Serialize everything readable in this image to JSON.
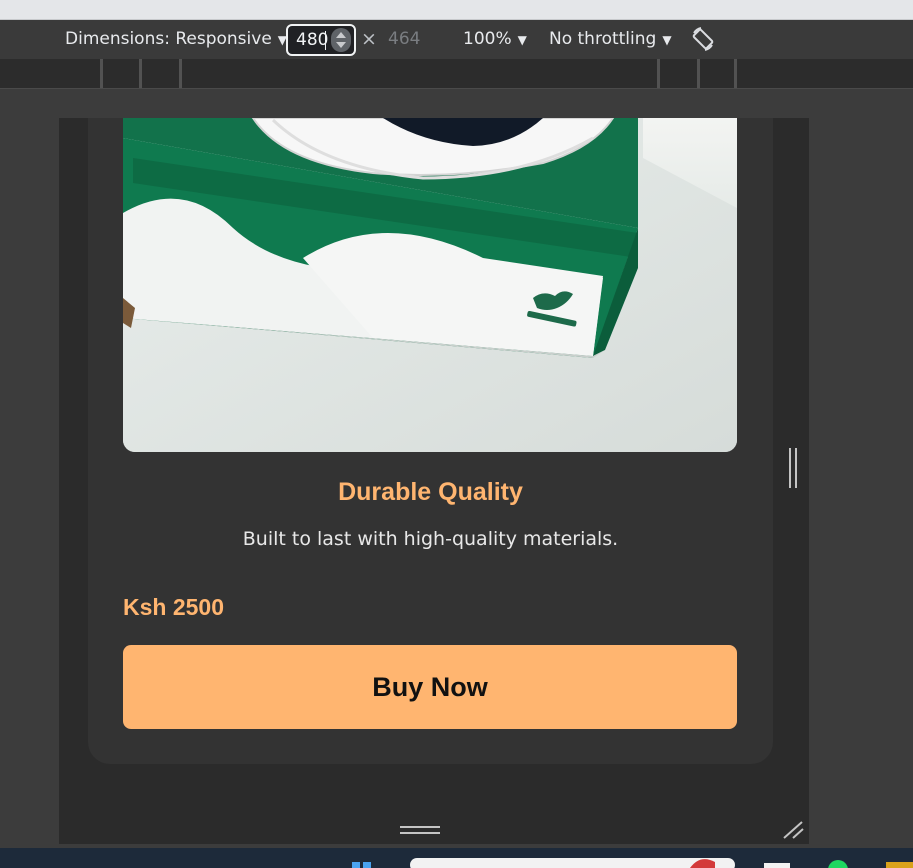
{
  "devtools": {
    "dimensions_label": "Dimensions: Responsive",
    "width_value": "480",
    "times_symbol": "×",
    "height_value": "464",
    "zoom_label": "100%",
    "throttle_label": "No throttling",
    "caret": "▼",
    "rotate_icon": "rotate-icon"
  },
  "card": {
    "title": "Durable Quality",
    "description": "Built to last with high-quality materials.",
    "price": "Ksh 2500",
    "button_label": "Buy Now"
  },
  "colors": {
    "accent": "#ffb570",
    "card_bg": "#333333",
    "viewport_bg": "#2b2b2b"
  }
}
